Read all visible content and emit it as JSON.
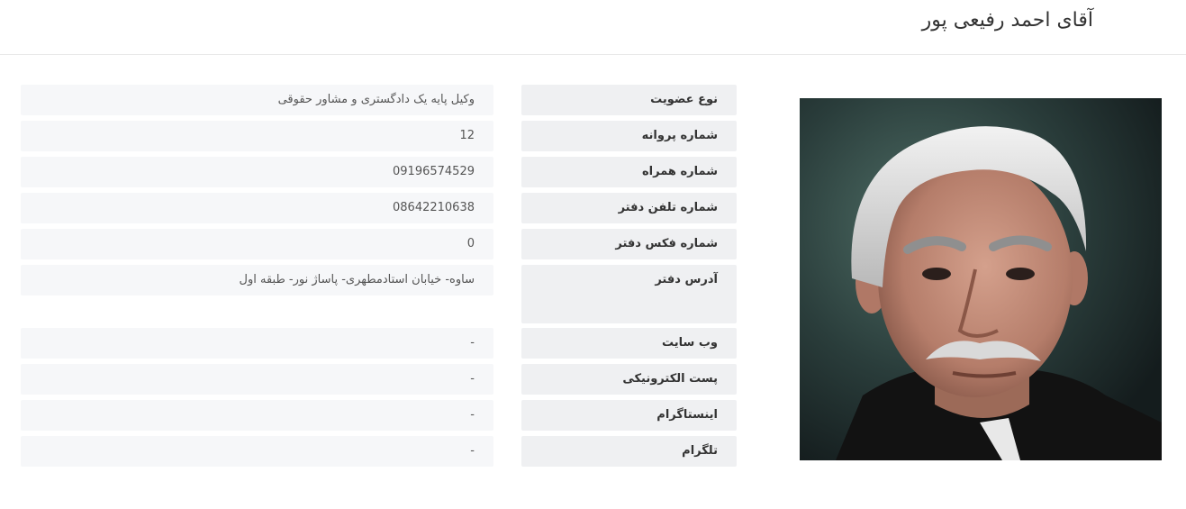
{
  "header": {
    "title": "آقای احمد رفیعی پور"
  },
  "profile": {
    "photo_icon": "portrait-photo",
    "fields": [
      {
        "label": "نوع عضویت",
        "value": "وکیل پایه یک دادگستری و مشاور حقوقی"
      },
      {
        "label": "شماره پروانه",
        "value": "12"
      },
      {
        "label": "شماره همراه",
        "value": "09196574529"
      },
      {
        "label": "شماره تلفن دفتر",
        "value": "08642210638"
      },
      {
        "label": "شماره فکس دفتر",
        "value": "0"
      },
      {
        "label": "آدرس دفتر",
        "value": "ساوه- خیابان استادمطهری- پاساژ نور- طبقه اول"
      },
      {
        "label": "وب سایت",
        "value": "-"
      },
      {
        "label": "پست الکترونیکی",
        "value": "-"
      },
      {
        "label": "اینستاگرام",
        "value": "-"
      },
      {
        "label": "تلگرام",
        "value": "-"
      }
    ]
  }
}
